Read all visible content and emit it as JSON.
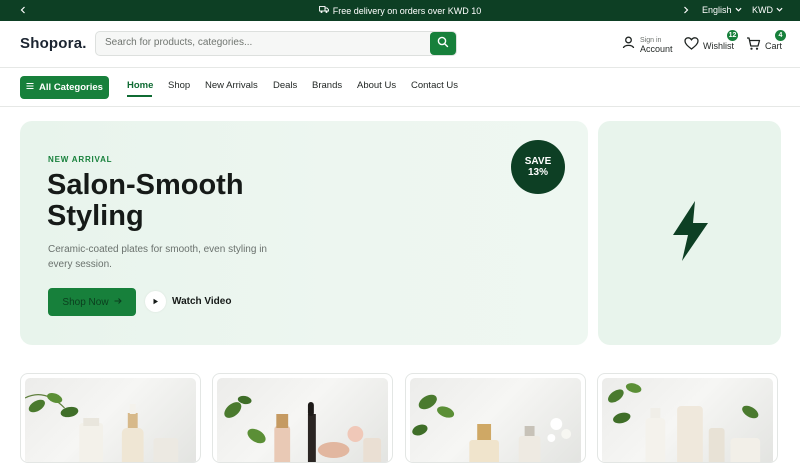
{
  "topbar": {
    "promo": "Free delivery on orders over KWD 10",
    "language": "English",
    "currency": "KWD"
  },
  "header": {
    "logo": "Shopora.",
    "search_placeholder": "Search for products, categories...",
    "account_small": "Sign in",
    "account_big": "Account",
    "wishlist_label": "Wishlist",
    "wishlist_count": "12",
    "cart_label": "Cart",
    "cart_count": "4"
  },
  "nav": {
    "all_categories": "All Categories",
    "links": [
      "Home",
      "Shop",
      "New Arrivals",
      "Deals",
      "Brands",
      "About Us",
      "Contact Us"
    ],
    "active": "Home"
  },
  "hero": {
    "eyebrow": "NEW ARRIVAL",
    "title": "Salon-Smooth Styling",
    "description": "Ceramic-coated plates for smooth, even styling in every session.",
    "cta": "Shop Now",
    "secondary": "Watch Video",
    "badge_line1": "SAVE",
    "badge_line2": "13%"
  },
  "side_card": {
    "icon": "lightning-bolt-icon"
  },
  "products": [
    {
      "image": "skincare-bottles-with-leaves"
    },
    {
      "image": "makeup-products-with-leaves"
    },
    {
      "image": "perfume-bottles-with-flowers"
    },
    {
      "image": "cosmetic-bottles-with-leaves"
    }
  ],
  "colors": {
    "primary": "#17803b",
    "dark": "#0d3f24",
    "hero_bg": "#e8f4ec"
  }
}
